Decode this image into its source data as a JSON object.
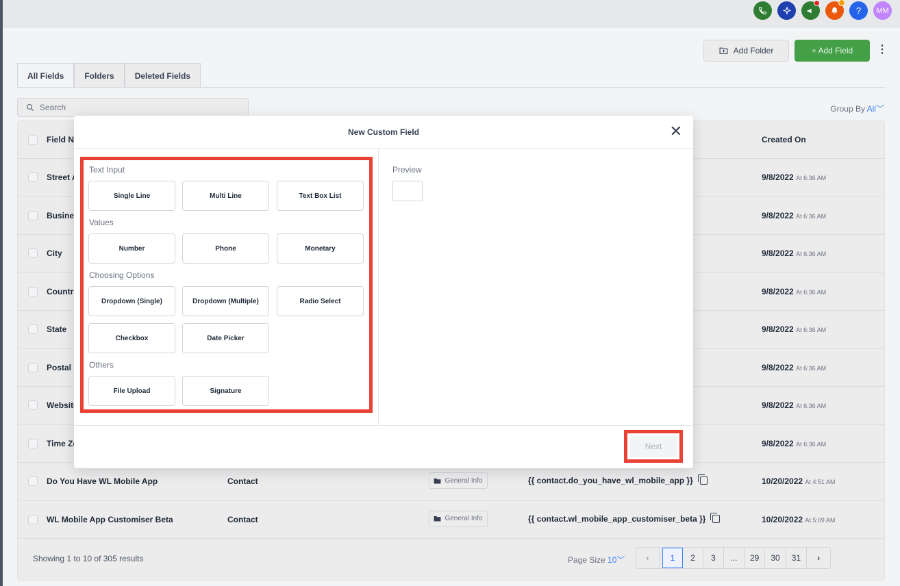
{
  "topbar": {
    "icons": [
      {
        "name": "phone-icon",
        "glyph": "✆",
        "color": "#2e7d32"
      },
      {
        "name": "sparkle-icon",
        "glyph": "✧",
        "color": "#1e40af"
      },
      {
        "name": "megaphone-icon",
        "glyph": "📢",
        "color": "#2e7d32"
      },
      {
        "name": "bell-icon",
        "glyph": "🔔",
        "color": "#ea580c"
      },
      {
        "name": "help-icon",
        "glyph": "?",
        "color": "#2563eb"
      },
      {
        "name": "avatar",
        "glyph": "MM",
        "color": "#c084fc"
      }
    ]
  },
  "actions": {
    "add_folder": "Add Folder",
    "add_field": "+ Add Field"
  },
  "tabs": [
    "All Fields",
    "Folders",
    "Deleted Fields"
  ],
  "search": {
    "placeholder": "Search"
  },
  "group_by": {
    "label": "Group By",
    "value": "All"
  },
  "table": {
    "headers": {
      "field_name": "Field N",
      "created_on": "Created On"
    },
    "rows": [
      {
        "name": "Street A",
        "date": "9/8/2022",
        "time": "At 6:36 AM"
      },
      {
        "name": "Busines",
        "date": "9/8/2022",
        "time": "At 6:36 AM"
      },
      {
        "name": "City",
        "date": "9/8/2022",
        "time": "At 6:36 AM"
      },
      {
        "name": "Country",
        "date": "9/8/2022",
        "time": "At 6:36 AM"
      },
      {
        "name": "State",
        "date": "9/8/2022",
        "time": "At 6:36 AM"
      },
      {
        "name": "Postal (",
        "date": "9/8/2022",
        "time": "At 6:36 AM"
      },
      {
        "name": "Website",
        "date": "9/8/2022",
        "time": "At 6:36 AM"
      },
      {
        "name": "Time Zo",
        "date": "9/8/2022",
        "time": "At 6:36 AM"
      },
      {
        "name": "Do You Have WL Mobile App",
        "object": "Contact",
        "folder": "General Info",
        "key": "{{ contact.do_you_have_wl_mobile_app }}",
        "date": "10/20/2022",
        "time": "At 4:51 AM"
      },
      {
        "name": "WL Mobile App Customiser Beta",
        "object": "Contact",
        "folder": "General Info",
        "key": "{{ contact.wl_mobile_app_customiser_beta }}",
        "date": "10/20/2022",
        "time": "At 5:09 AM"
      }
    ],
    "footer": "Showing 1 to 10 of 305 results",
    "page_size": {
      "label": "Page Size",
      "value": "10"
    },
    "pages": [
      "1",
      "2",
      "3",
      "...",
      "29",
      "30",
      "31"
    ]
  },
  "modal": {
    "title": "New Custom Field",
    "sections": {
      "text_input": "Text Input",
      "values": "Values",
      "choosing": "Choosing Options",
      "others": "Others"
    },
    "types": {
      "single_line": "Single Line",
      "multi_line": "Multi Line",
      "text_box_list": "Text Box List",
      "number": "Number",
      "phone": "Phone",
      "monetary": "Monetary",
      "dropdown_single": "Dropdown (Single)",
      "dropdown_multiple": "Dropdown (Multiple)",
      "radio_select": "Radio Select",
      "checkbox": "Checkbox",
      "date_picker": "Date Picker",
      "file_upload": "File Upload",
      "signature": "Signature"
    },
    "preview_label": "Preview",
    "next": "Next",
    "highlight_color": "#e94234"
  }
}
